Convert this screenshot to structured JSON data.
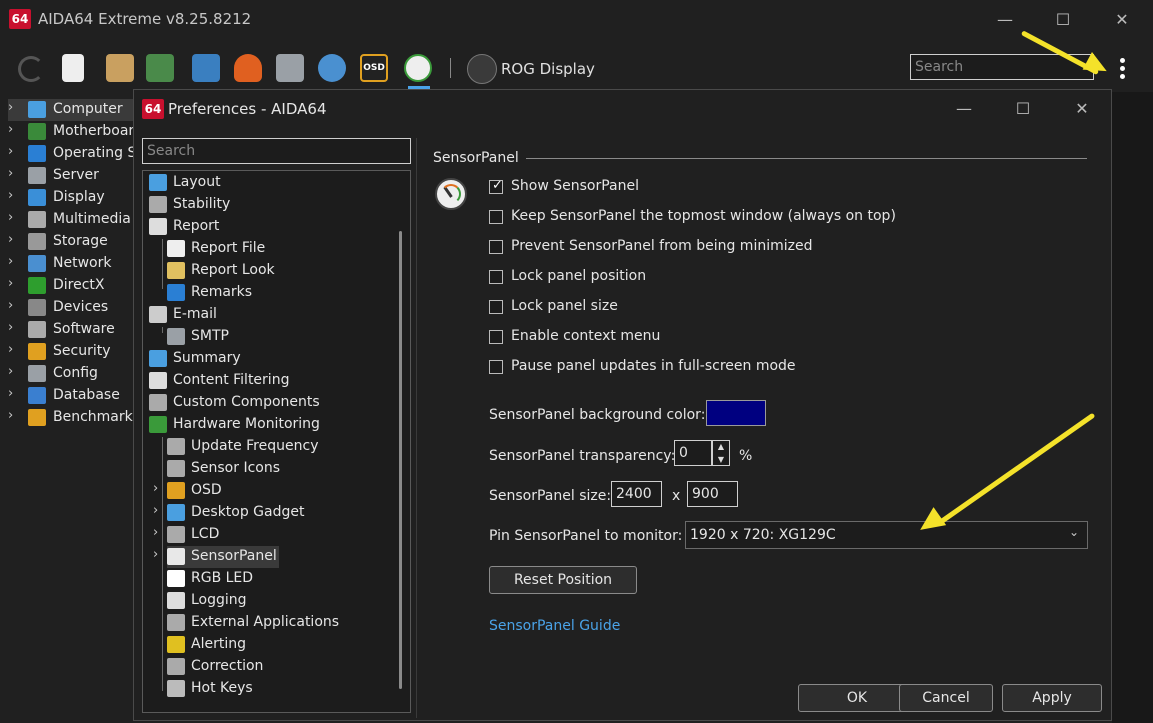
{
  "app": {
    "logo": "64",
    "title": "AIDA64 Extreme v8.25.8212"
  },
  "window_controls": {
    "minimize": "—",
    "maximize": "☐",
    "close": "✕"
  },
  "toolbar": {
    "rog_label": "ROG Display",
    "search_placeholder": "Search"
  },
  "tree": [
    {
      "label": "Computer",
      "icon": "computer-icon",
      "color": "#4a9fe0"
    },
    {
      "label": "Motherboard",
      "icon": "motherboard-icon",
      "color": "#3a8a3a"
    },
    {
      "label": "Operating System",
      "icon": "windows-icon",
      "color": "#2a7fd4"
    },
    {
      "label": "Server",
      "icon": "server-icon",
      "color": "#9aa0a6"
    },
    {
      "label": "Display",
      "icon": "display-icon",
      "color": "#3a8fd8"
    },
    {
      "label": "Multimedia",
      "icon": "multimedia-icon",
      "color": "#aaaaaa"
    },
    {
      "label": "Storage",
      "icon": "storage-icon",
      "color": "#999999"
    },
    {
      "label": "Network",
      "icon": "network-icon",
      "color": "#4a8fd0"
    },
    {
      "label": "DirectX",
      "icon": "xbox-icon",
      "color": "#2e9e2e"
    },
    {
      "label": "Devices",
      "icon": "devices-icon",
      "color": "#888888"
    },
    {
      "label": "Software",
      "icon": "software-icon",
      "color": "#aaaaaa"
    },
    {
      "label": "Security",
      "icon": "shield-icon",
      "color": "#e0a020"
    },
    {
      "label": "Config",
      "icon": "config-icon",
      "color": "#9aa0a6"
    },
    {
      "label": "Database",
      "icon": "database-icon",
      "color": "#3a7fd0"
    },
    {
      "label": "Benchmark",
      "icon": "benchmark-icon",
      "color": "#e0a020"
    }
  ],
  "prefs": {
    "logo": "64",
    "title": "Preferences - AIDA64",
    "search_placeholder": "Search",
    "tree": [
      {
        "label": "Layout",
        "icon": "layout-icon",
        "color": "#4a9fe0",
        "level": 0
      },
      {
        "label": "Stability",
        "icon": "gear-icon",
        "color": "#aaaaaa",
        "level": 0
      },
      {
        "label": "Report",
        "icon": "report-icon",
        "color": "#dddddd",
        "level": 0
      },
      {
        "label": "Report File",
        "icon": "file-icon",
        "color": "#eeeeee",
        "level": 1
      },
      {
        "label": "Report Look",
        "icon": "report-look-icon",
        "color": "#e0c060",
        "level": 1
      },
      {
        "label": "Remarks",
        "icon": "info-icon",
        "color": "#2a7fd4",
        "level": 1
      },
      {
        "label": "E-mail",
        "icon": "email-icon",
        "color": "#cccccc",
        "level": 0
      },
      {
        "label": "SMTP",
        "icon": "smtp-icon",
        "color": "#9aa0a6",
        "level": 1
      },
      {
        "label": "Summary",
        "icon": "summary-icon",
        "color": "#4a9fe0",
        "level": 0
      },
      {
        "label": "Content Filtering",
        "icon": "filter-icon",
        "color": "#dddddd",
        "level": 0
      },
      {
        "label": "Custom Components",
        "icon": "components-icon",
        "color": "#aaaaaa",
        "level": 0
      },
      {
        "label": "Hardware Monitoring",
        "icon": "monitoring-icon",
        "color": "#3a9a3a",
        "level": 0
      },
      {
        "label": "Update Frequency",
        "icon": "clock-icon",
        "color": "#aaaaaa",
        "level": 1
      },
      {
        "label": "Sensor Icons",
        "icon": "sensor-icons-icon",
        "color": "#aaaaaa",
        "level": 1
      },
      {
        "label": "OSD",
        "icon": "osd-icon",
        "color": "#e0a020",
        "level": 1,
        "expandable": true
      },
      {
        "label": "Desktop Gadget",
        "icon": "gadget-icon",
        "color": "#4a9fe0",
        "level": 1,
        "expandable": true
      },
      {
        "label": "LCD",
        "icon": "lcd-icon",
        "color": "#aaaaaa",
        "level": 1,
        "expandable": true
      },
      {
        "label": "SensorPanel",
        "icon": "gauge-icon",
        "color": "#e8e8e8",
        "level": 1,
        "expandable": true,
        "selected": true
      },
      {
        "label": "RGB LED",
        "icon": "rgb-led-icon",
        "color": "#ffffff",
        "level": 1
      },
      {
        "label": "Logging",
        "icon": "logging-icon",
        "color": "#dddddd",
        "level": 1
      },
      {
        "label": "External Applications",
        "icon": "external-apps-icon",
        "color": "#aaaaaa",
        "level": 1
      },
      {
        "label": "Alerting",
        "icon": "warning-icon",
        "color": "#e0c020",
        "level": 1
      },
      {
        "label": "Correction",
        "icon": "correction-icon",
        "color": "#aaaaaa",
        "level": 1
      },
      {
        "label": "Hot Keys",
        "icon": "hotkeys-icon",
        "color": "#bbbbbb",
        "level": 1
      }
    ],
    "section_title": "SensorPanel",
    "options": [
      {
        "label": "Show SensorPanel",
        "checked": true
      },
      {
        "label": "Keep SensorPanel the topmost window (always on top)",
        "checked": false
      },
      {
        "label": "Prevent SensorPanel from being minimized",
        "checked": false
      },
      {
        "label": "Lock panel position",
        "checked": false
      },
      {
        "label": "Lock panel size",
        "checked": false
      },
      {
        "label": "Enable context menu",
        "checked": false
      },
      {
        "label": "Pause panel updates in full-screen mode",
        "checked": false
      }
    ],
    "bg_color_label": "SensorPanel background color:",
    "bg_color": "#000080",
    "transparency_label": "SensorPanel transparency:",
    "transparency_value": "0",
    "transparency_unit": "%",
    "size_label": "SensorPanel size:",
    "size_width": "2400",
    "size_sep": "x",
    "size_height": "900",
    "pin_label": "Pin SensorPanel to monitor:",
    "pin_value": "1920 x 720: XG129C",
    "reset_button": "Reset Position",
    "guide_link": "SensorPanel Guide",
    "ok_button": "OK",
    "cancel_button": "Cancel",
    "apply_button": "Apply"
  }
}
